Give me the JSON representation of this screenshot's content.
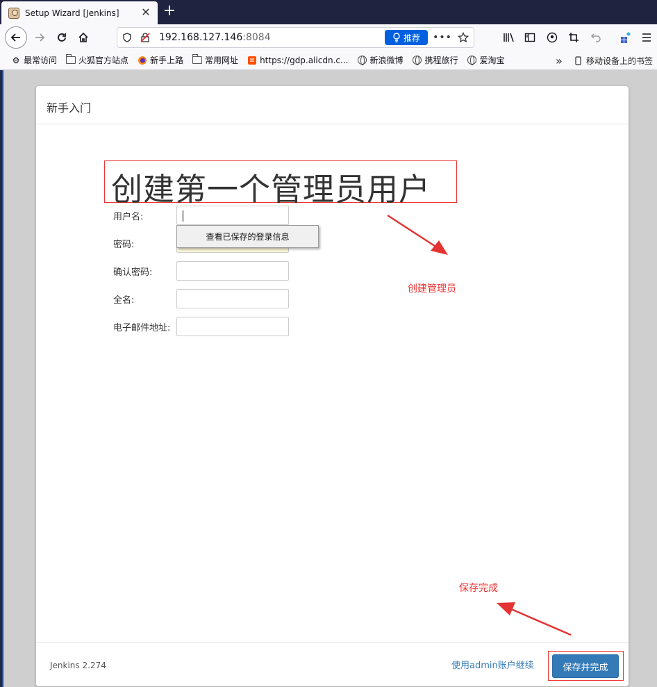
{
  "browser": {
    "tab_title": "Setup Wizard [Jenkins]",
    "tab_close": "✕",
    "new_tab": "+",
    "url_host": "192.168.127.146",
    "url_port": ":8084",
    "recommend_label": "推荐",
    "bookmarks": [
      {
        "label": "最常访问",
        "icon": "gear-icon"
      },
      {
        "label": "火狐官方站点",
        "icon": "folder-icon"
      },
      {
        "label": "新手上路",
        "icon": "firefox-icon"
      },
      {
        "label": "常用网址",
        "icon": "folder-icon"
      },
      {
        "label": "https://gdp.alicdn.c...",
        "icon": "alicdn-icon"
      },
      {
        "label": "新浪微博",
        "icon": "globe-icon"
      },
      {
        "label": "携程旅行",
        "icon": "globe-icon"
      },
      {
        "label": "爱淘宝",
        "icon": "globe-icon"
      }
    ],
    "mobile_bookmarks": "移动设备上的书签"
  },
  "panel": {
    "header_title": "新手入门",
    "big_title": "创建第一个管理员用户",
    "fields": [
      {
        "label": "用户名:",
        "value": "",
        "placeholder": ""
      },
      {
        "label": "密码:",
        "value": "",
        "placeholder": ""
      },
      {
        "label": "确认密码:",
        "value": "",
        "placeholder": ""
      },
      {
        "label": "全名:",
        "value": "",
        "placeholder": ""
      },
      {
        "label": "电子邮件地址:",
        "value": "",
        "placeholder": ""
      }
    ],
    "autocomplete_label": "查看已保存的登录信息",
    "version": "Jenkins 2.274",
    "continue_link": "使用admin账户继续",
    "save_button": "保存并完成"
  },
  "annotations": {
    "create_admin": "创建管理员",
    "save_done": "保存完成",
    "color": "#e33333"
  },
  "colors": {
    "primary": "#337ab7",
    "tabbar": "#202340",
    "firefox_blue": "#0060df"
  }
}
